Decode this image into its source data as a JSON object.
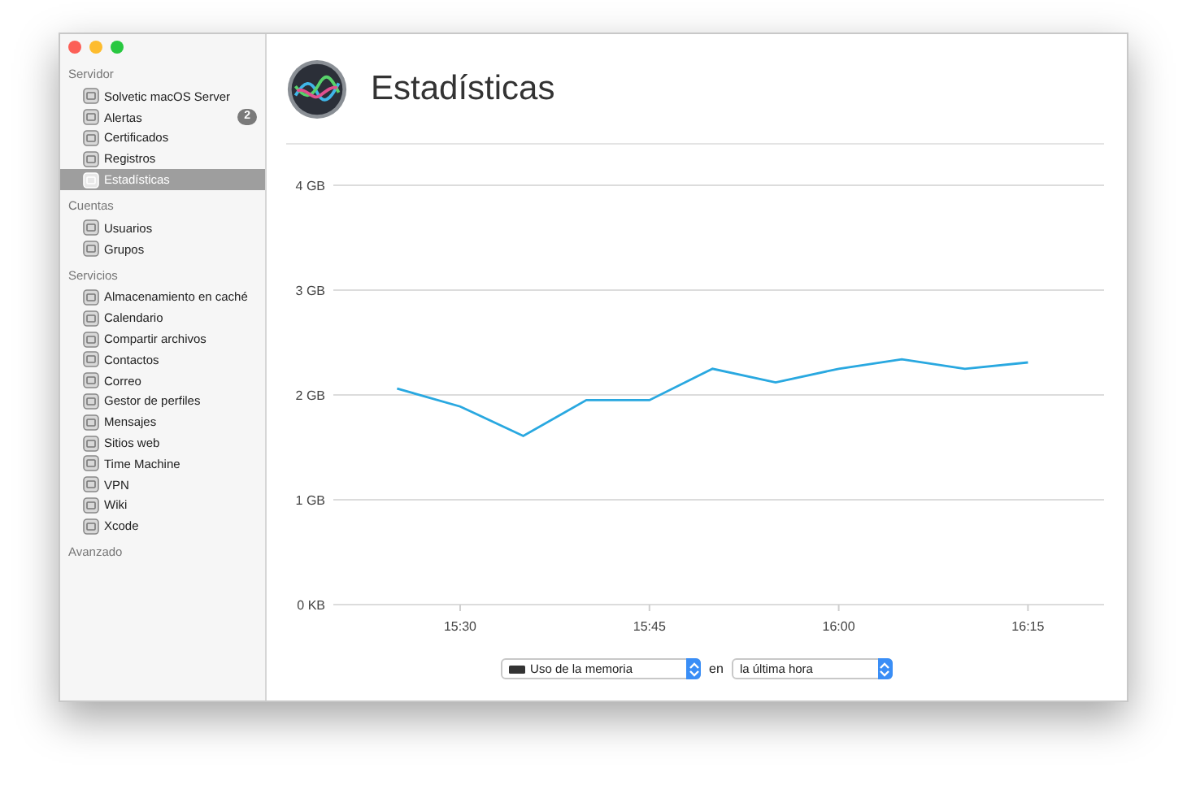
{
  "sidebar": {
    "sections": [
      {
        "title": "Servidor",
        "items": [
          {
            "label": "Solvetic macOS Server",
            "selected": false
          },
          {
            "label": "Alertas",
            "badge": "2",
            "selected": false
          },
          {
            "label": "Certificados",
            "selected": false
          },
          {
            "label": "Registros",
            "selected": false
          },
          {
            "label": "Estadísticas",
            "selected": true
          }
        ]
      },
      {
        "title": "Cuentas",
        "items": [
          {
            "label": "Usuarios",
            "selected": false
          },
          {
            "label": "Grupos",
            "selected": false
          }
        ]
      },
      {
        "title": "Servicios",
        "items": [
          {
            "label": "Almacenamiento en caché",
            "selected": false
          },
          {
            "label": "Calendario",
            "selected": false
          },
          {
            "label": "Compartir archivos",
            "selected": false
          },
          {
            "label": "Contactos",
            "selected": false
          },
          {
            "label": "Correo",
            "selected": false
          },
          {
            "label": "Gestor de perfiles",
            "selected": false
          },
          {
            "label": "Mensajes",
            "selected": false
          },
          {
            "label": "Sitios web",
            "selected": false
          },
          {
            "label": "Time Machine",
            "selected": false
          },
          {
            "label": "VPN",
            "selected": false
          },
          {
            "label": "Wiki",
            "selected": false
          },
          {
            "label": "Xcode",
            "selected": false
          }
        ]
      },
      {
        "title": "Avanzado"
      }
    ]
  },
  "header": {
    "title": "Estadísticas"
  },
  "chart": {
    "chart_data": {
      "type": "line",
      "categories": [
        null,
        "15:30",
        null,
        null,
        "15:45",
        null,
        null,
        "16:00",
        null,
        null,
        "16:15"
      ],
      "series": [
        {
          "color": "#29a8e0",
          "values": [
            2.06,
            1.89,
            1.61,
            1.95,
            1.95,
            2.25,
            2.12,
            2.25,
            2.34,
            2.25,
            2.31
          ]
        }
      ],
      "ylim": [
        0,
        4
      ],
      "grid": true,
      "yticks": [
        {
          "value": 0,
          "label": "0 KB"
        },
        {
          "value": 1,
          "label": "1 GB"
        },
        {
          "value": 2,
          "label": "2 GB"
        },
        {
          "value": 3,
          "label": "3 GB"
        },
        {
          "value": 4,
          "label": "4 GB"
        }
      ]
    }
  },
  "controls": {
    "metric": "Uso de la memoria",
    "joiner": "en",
    "period": "la última hora"
  }
}
